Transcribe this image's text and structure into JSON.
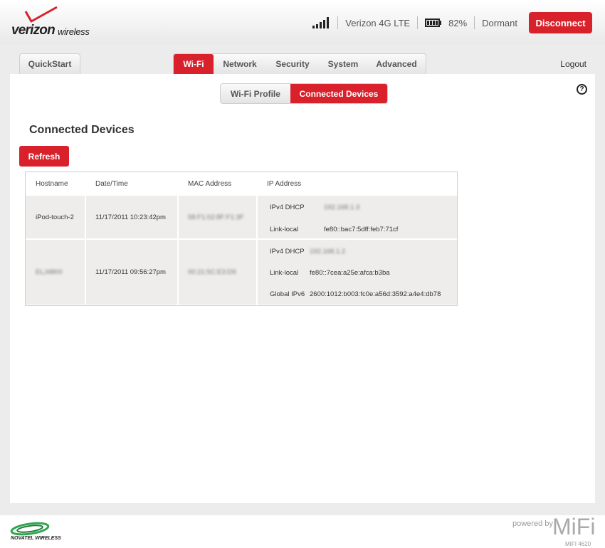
{
  "brand": {
    "name": "verizon",
    "sub": "wireless",
    "check_color": "#d8212b"
  },
  "status": {
    "network": "Verizon 4G LTE",
    "battery": "82%",
    "state": "Dormant",
    "disconnect_label": "Disconnect",
    "signal_bars": 5,
    "battery_cells": 4
  },
  "nav": {
    "quickstart": "QuickStart",
    "tabs": [
      "Wi-Fi",
      "Network",
      "Security",
      "System",
      "Advanced"
    ],
    "active_tab": "Wi-Fi",
    "logout": "Logout"
  },
  "subtabs": {
    "items": [
      "Wi-Fi Profile",
      "Connected Devices"
    ],
    "active": "Connected Devices"
  },
  "help_icon": "?",
  "page": {
    "title": "Connected Devices",
    "refresh_label": "Refresh"
  },
  "table": {
    "headers": [
      "Hostname",
      "Date/Time",
      "MAC Address",
      "IP Address"
    ],
    "rows": [
      {
        "hostname": "iPod-touch-2",
        "datetime": "11/17/2011 10:23:42pm",
        "mac": "58:F1:02:8F:F1:3F",
        "ips": [
          {
            "label": "IPv4 DHCP",
            "value": "192.168.1.3"
          },
          {
            "label": "Link-local",
            "value": "fe80::bac7:5dff:feb7:71cf"
          }
        ]
      },
      {
        "hostname": "ELJ4800",
        "datetime": "11/17/2011 09:56:27pm",
        "mac": "00:21:5C:E3:D9",
        "ips": [
          {
            "label": "IPv4 DHCP",
            "value": "192.168.1.2"
          },
          {
            "label": "Link-local",
            "value": "fe80::7cea:a25e:afca:b3ba"
          },
          {
            "label": "Global IPv6",
            "value": "2600:1012:b003:fc0e:a56d:3592:a4e4:db78"
          }
        ]
      }
    ]
  },
  "footer": {
    "left_brand": "NOVATEL WIRELESS",
    "powered_by": "powered by",
    "mifi": "MiFi",
    "model": "MIFI 4620"
  }
}
